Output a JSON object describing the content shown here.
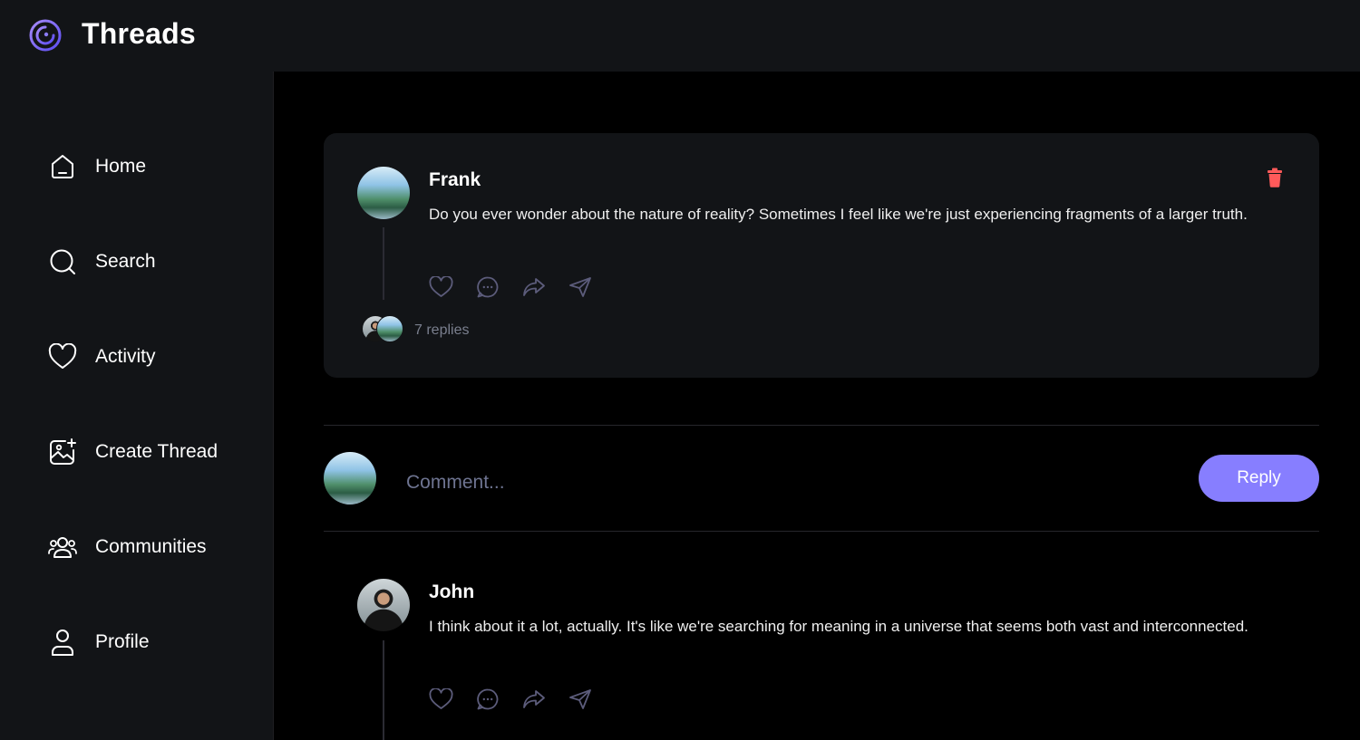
{
  "app": {
    "title": "Threads"
  },
  "sidebar": {
    "items": [
      {
        "label": "Home",
        "icon": "home-icon"
      },
      {
        "label": "Search",
        "icon": "search-icon"
      },
      {
        "label": "Activity",
        "icon": "heart-icon"
      },
      {
        "label": "Create Thread",
        "icon": "create-thread-icon"
      },
      {
        "label": "Communities",
        "icon": "communities-icon"
      },
      {
        "label": "Profile",
        "icon": "profile-icon"
      }
    ]
  },
  "thread": {
    "author": "Frank",
    "content": "Do you ever wonder about the nature of reality? Sometimes I feel like we're just experiencing fragments of a larger truth.",
    "replies_label": "7 replies",
    "actions": [
      "heart-icon",
      "reply-icon",
      "repost-icon",
      "share-icon"
    ]
  },
  "comment_form": {
    "placeholder": "Comment...",
    "submit_label": "Reply"
  },
  "replies": [
    {
      "author": "John",
      "content": "I think about it a lot, actually. It's like we're searching for meaning in a universe that seems both vast and interconnected."
    }
  ],
  "colors": {
    "accent": "#877eff",
    "delete": "#ff5a5a",
    "card_bg": "#121417",
    "muted": "#7a7f8e"
  }
}
